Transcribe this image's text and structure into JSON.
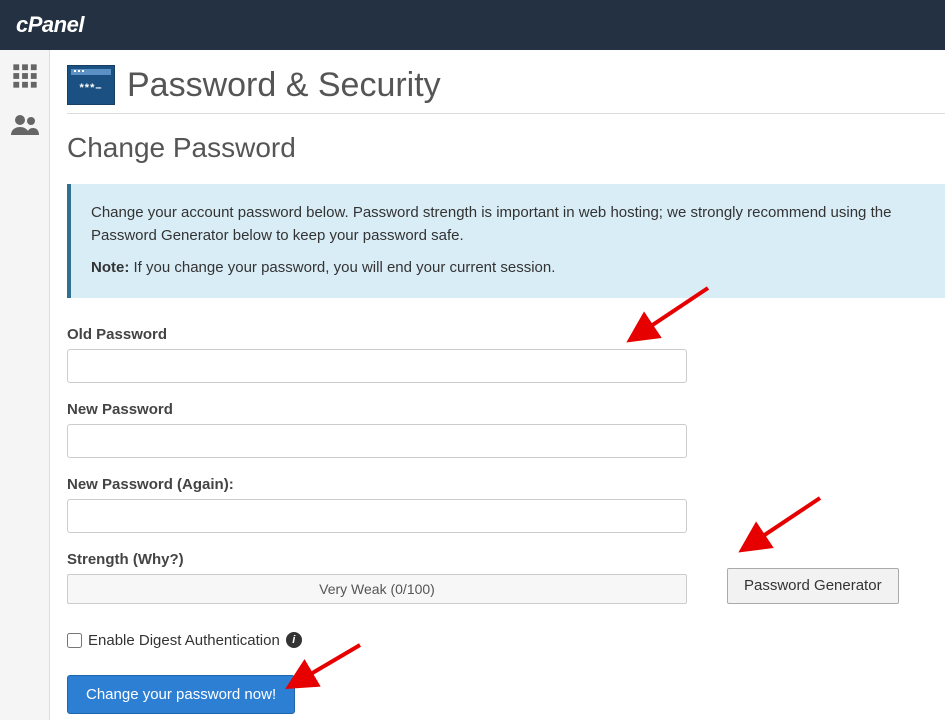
{
  "header": {
    "brand": "cPanel"
  },
  "page": {
    "title": "Password & Security",
    "section": "Change Password",
    "alert_text": "Change your account password below. Password strength is important in web hosting; we strongly recommend using the Password Generator below to keep your password safe.",
    "alert_note_label": "Note:",
    "alert_note_text": "If you change your password, you will end your current session."
  },
  "fields": {
    "old_password_label": "Old Password",
    "new_password_label": "New Password",
    "new_password_again_label": "New Password (Again):",
    "strength_label": "Strength (Why?)",
    "strength_value": "Very Weak (0/100)"
  },
  "buttons": {
    "password_generator": "Password Generator",
    "submit": "Change your password now!"
  },
  "checkbox": {
    "digest_label": "Enable Digest Authentication"
  }
}
